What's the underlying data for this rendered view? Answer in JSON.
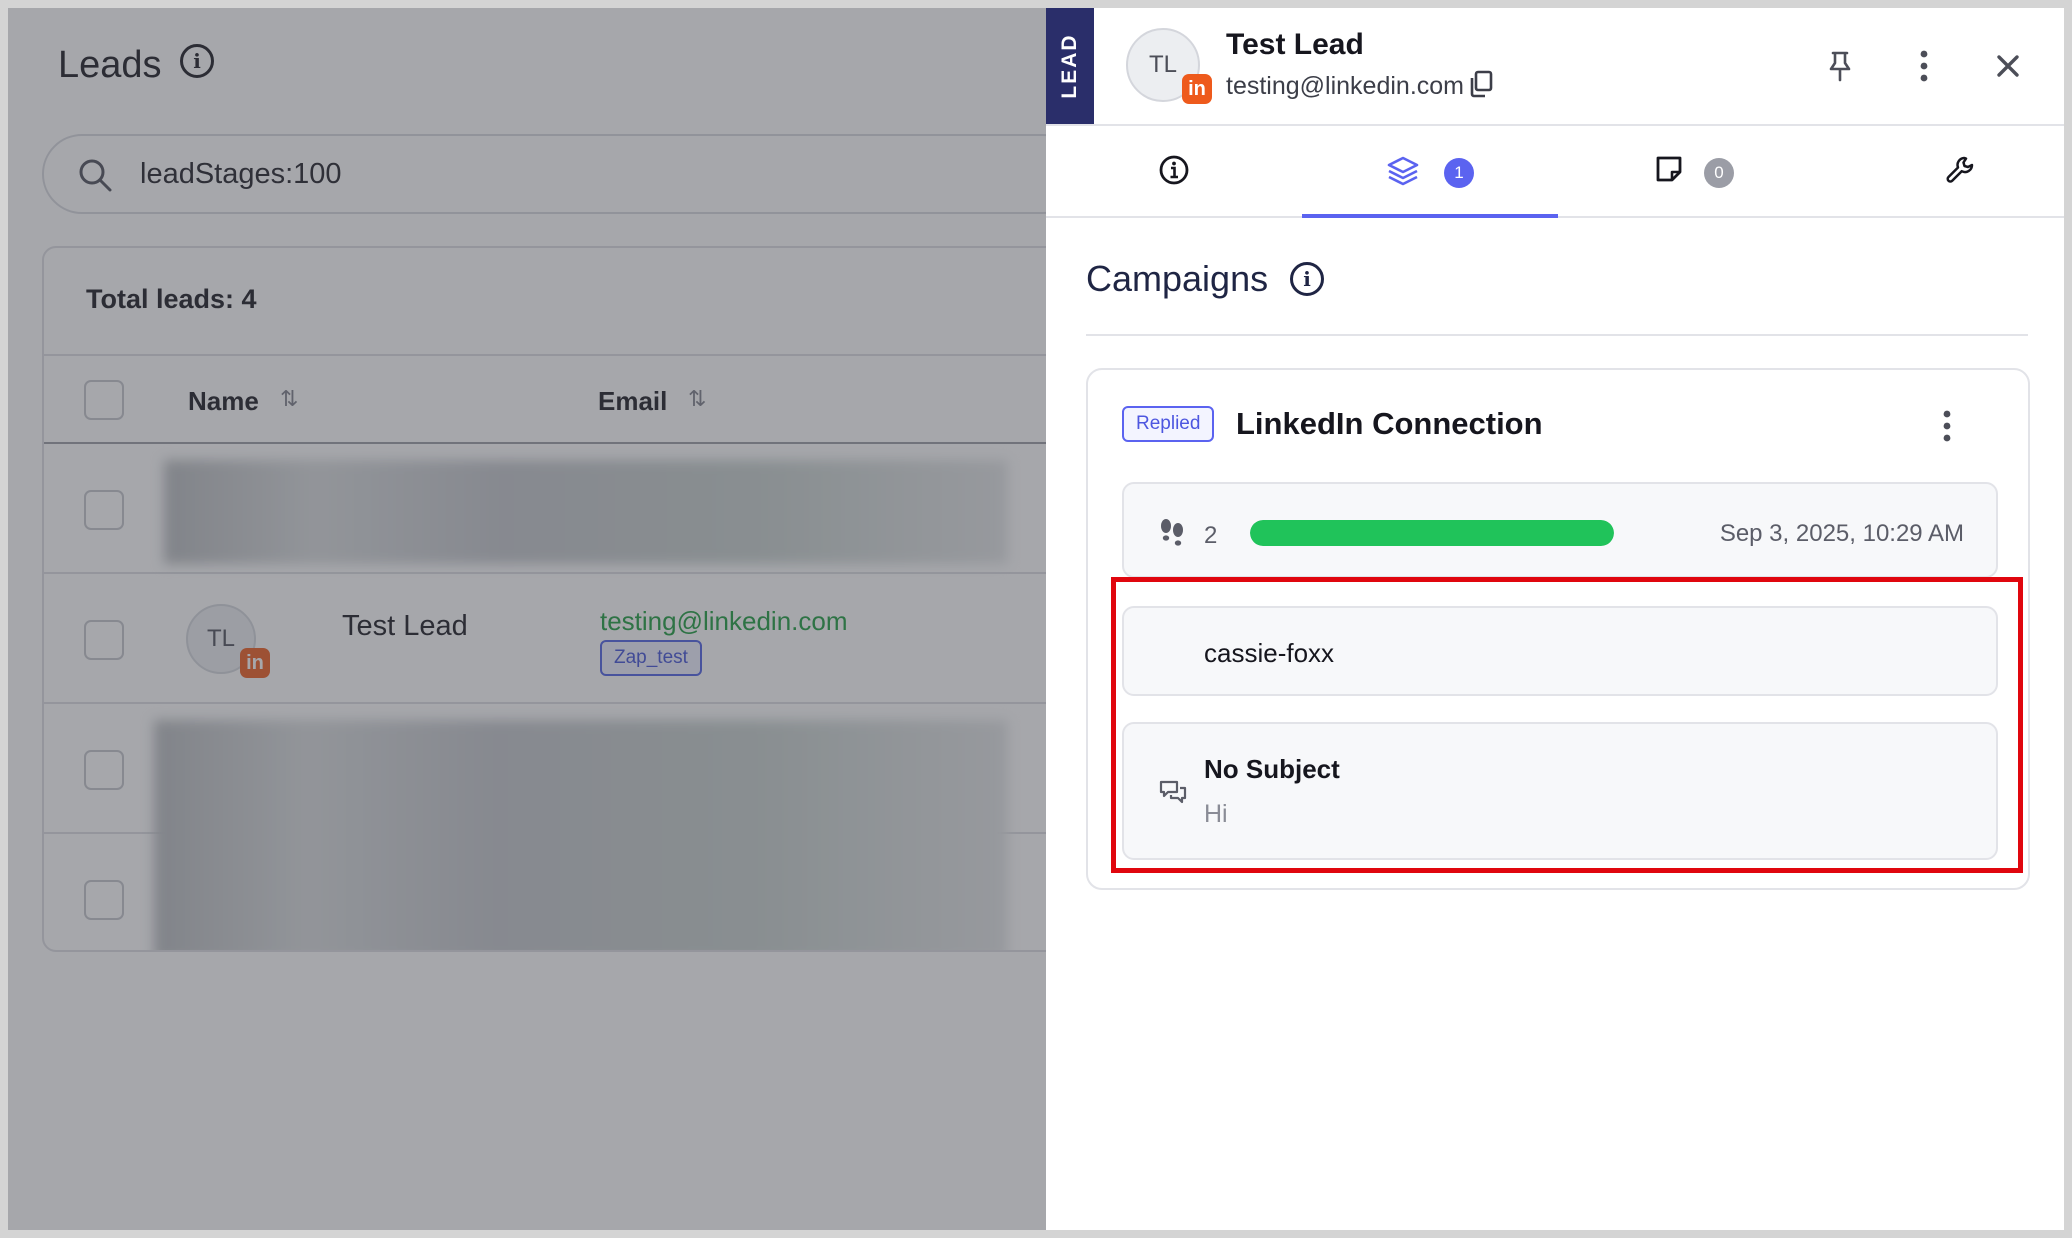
{
  "leads_page": {
    "title": "Leads",
    "search": {
      "value": "leadStages:100"
    },
    "total_leads": "Total leads: 4",
    "columns": {
      "name": "Name",
      "email": "Email"
    },
    "visible_row": {
      "initials": "TL",
      "name": "Test Lead",
      "email": "testing@linkedin.com",
      "tag": "Zap_test",
      "badge": "in"
    }
  },
  "drawer": {
    "strip_label": "LEAD",
    "avatar_initials": "TL",
    "avatar_badge": "in",
    "lead_name": "Test Lead",
    "lead_email": "testing@linkedin.com",
    "tabs": [
      {
        "icon": "info-icon"
      },
      {
        "icon": "layers-icon",
        "count": "1",
        "active": true
      },
      {
        "icon": "note-icon",
        "count": "0"
      },
      {
        "icon": "wrench-icon"
      }
    ],
    "section_title": "Campaigns",
    "campaign": {
      "status": "Replied",
      "name": "LinkedIn Connection",
      "steps": "2",
      "progress": 1.0,
      "date": "Sep 3, 2025, 10:29 AM",
      "from": "cassie-foxx",
      "message": {
        "subject": "No Subject",
        "body": "Hi"
      }
    }
  },
  "colors": {
    "accent": "#5b63f0",
    "progress": "#20c35a",
    "strip": "#2a2e6a",
    "linkedin_badge": "#ee5a1c",
    "highlight": "#e0060e"
  }
}
